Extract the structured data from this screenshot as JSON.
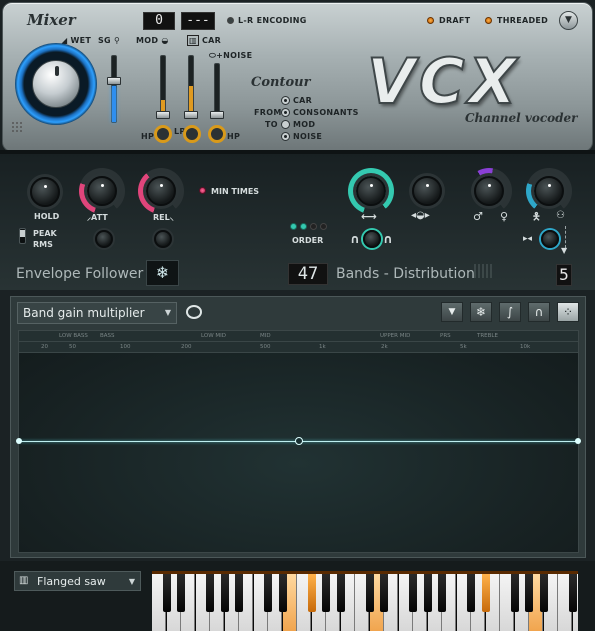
{
  "mixer": {
    "title": "Mixer",
    "wet": "WET",
    "sg": "SG",
    "mod": "MOD",
    "car": "CAR",
    "noise": "+NOISE",
    "lcd_left": "0",
    "lcd_right": "---",
    "lr_encoding": "L-R ENCODING",
    "hp": "HP",
    "lp": "LP",
    "hp2": "HP"
  },
  "options": {
    "draft": "DRAFT",
    "threaded": "THREADED"
  },
  "contour": {
    "title": "Contour",
    "from": "FROM",
    "to": "TO",
    "car": "CAR",
    "consonants": "CONSONANTS",
    "mod": "MOD",
    "noise": "NOISE"
  },
  "logo": {
    "title": "VCX",
    "subtitle": "Channel vocoder"
  },
  "envelope": {
    "hold": "HOLD",
    "att": "ATT",
    "rel": "REL",
    "min_times": "MIN TIMES",
    "peak": "PEAK",
    "rms": "RMS",
    "title": "Envelope Follower"
  },
  "bands": {
    "order": "ORDER",
    "count": "47",
    "title": "Bands - Distribution",
    "value": "5"
  },
  "editor": {
    "mode_select": "Band gain multiplier",
    "ranges": [
      "LOW BASS",
      "BASS",
      "LOW MID",
      "MID",
      "UPPER MID",
      "PRS",
      "TREBLE"
    ],
    "freqs": [
      "20",
      "50",
      "100",
      "200",
      "500",
      "1k",
      "2k",
      "5k",
      "10k"
    ]
  },
  "keyboard": {
    "carrier_select": "Flanged saw"
  },
  "colors": {
    "accent_teal": "#34c9b0",
    "accent_pink": "#e0457b",
    "accent_orange": "#e08a1a",
    "accent_blue": "#3aa6ff"
  }
}
